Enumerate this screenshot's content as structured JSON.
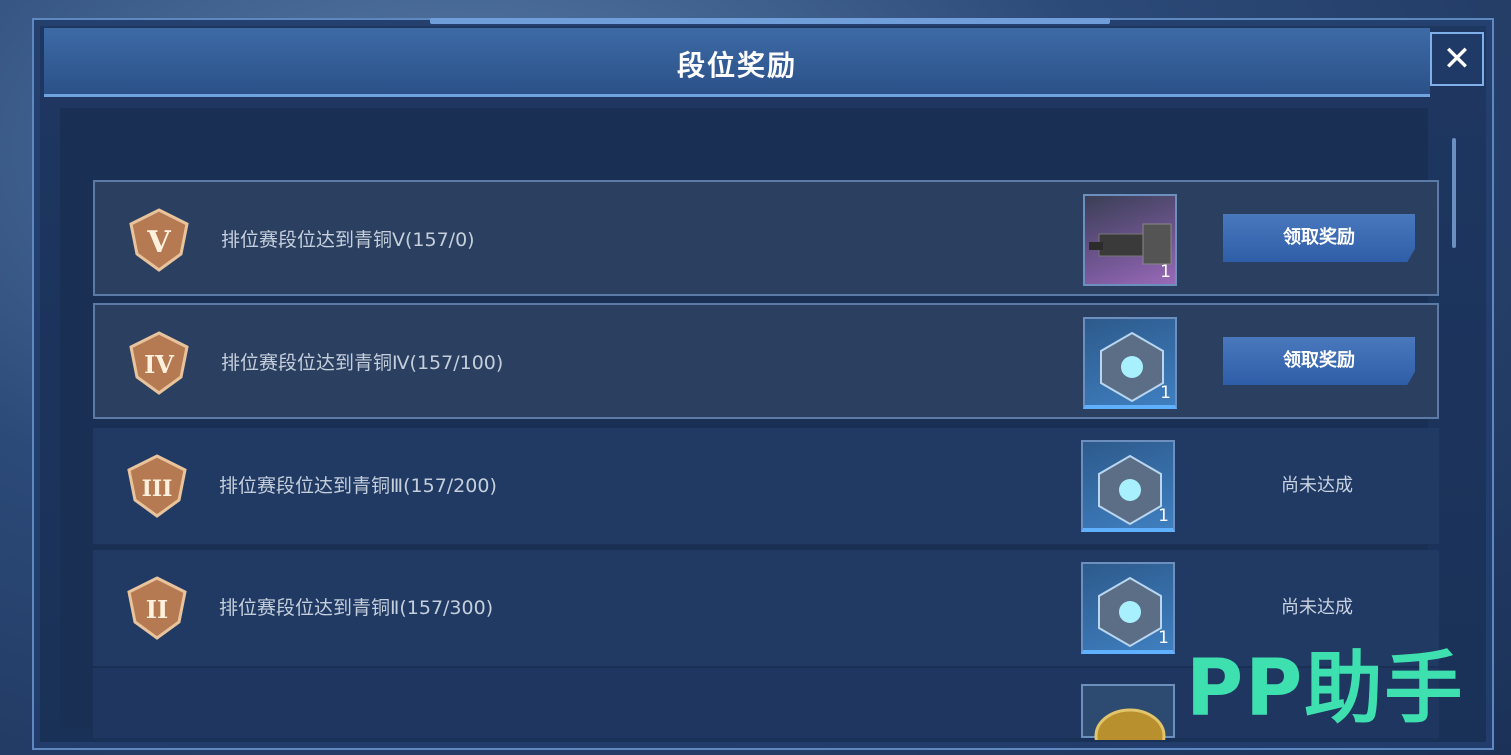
{
  "dialog": {
    "title": "段位奖励",
    "close_icon": "close-icon"
  },
  "rewards": [
    {
      "badge": "V",
      "text": "排位赛段位达到青铜Ⅴ(157/0)",
      "item_count": "1",
      "item": "purple-gun",
      "action": "领取奖励",
      "state": "claimable"
    },
    {
      "badge": "IV",
      "text": "排位赛段位达到青铜Ⅳ(157/100)",
      "item_count": "1",
      "item": "crystal-cube",
      "action": "领取奖励",
      "state": "claimable"
    },
    {
      "badge": "III",
      "text": "排位赛段位达到青铜Ⅲ(157/200)",
      "item_count": "1",
      "item": "crystal-cube",
      "action": "尚未达成",
      "state": "locked"
    },
    {
      "badge": "II",
      "text": "排位赛段位达到青铜Ⅱ(157/300)",
      "item_count": "1",
      "item": "crystal-cube",
      "action": "尚未达成",
      "state": "locked"
    }
  ],
  "watermark": "PP助手",
  "colors": {
    "accent": "#4a78bd",
    "header": "#2b5188",
    "watermark": "#3ee0b0"
  }
}
